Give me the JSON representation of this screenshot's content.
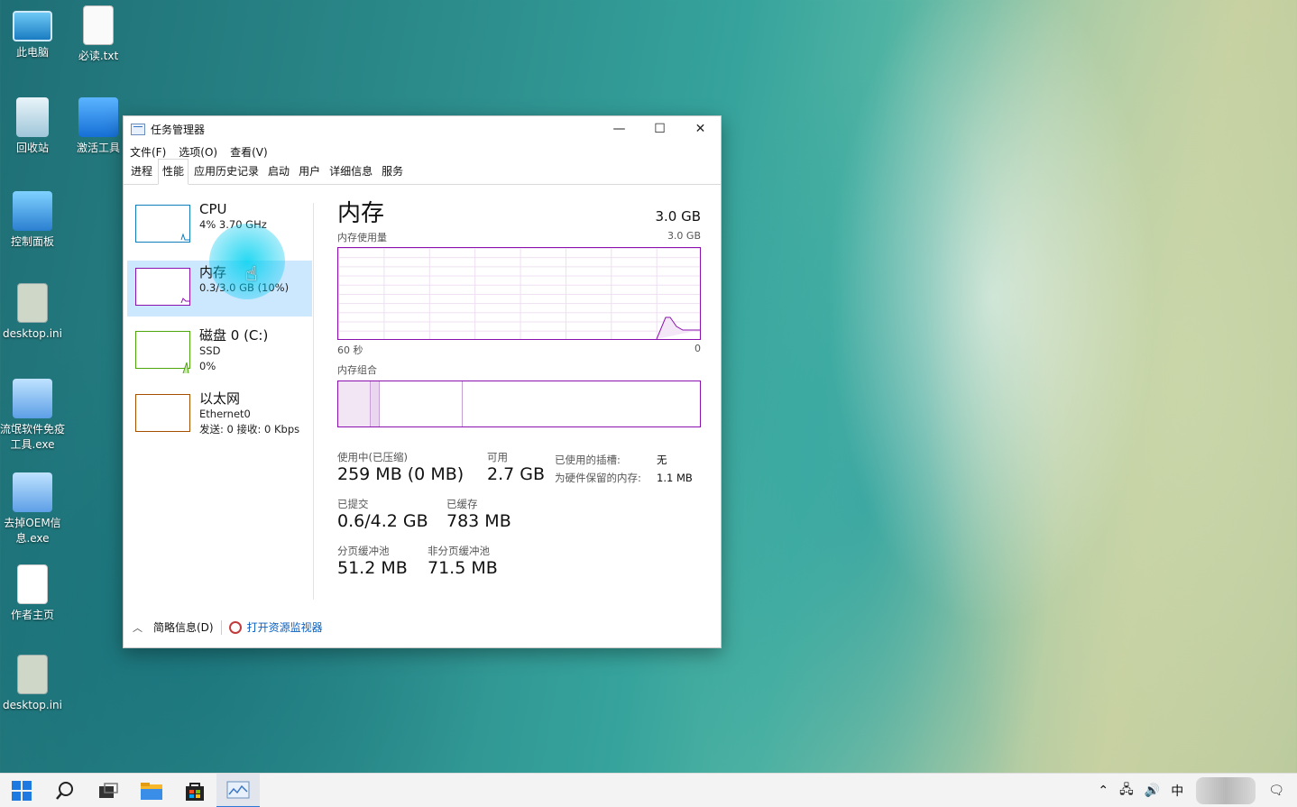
{
  "desktop": {
    "icons": [
      "此电脑",
      "必读.txt",
      "回收站",
      "激活工具",
      "控制面板",
      "desktop.ini",
      "流氓软件免疫工具.exe",
      "去掉OEM信息.exe",
      "作者主页",
      "desktop.ini"
    ]
  },
  "window": {
    "title": "任务管理器",
    "controls": {
      "minimize": "—",
      "maximize": "☐",
      "close": "✕"
    },
    "menu": [
      "文件(F)",
      "选项(O)",
      "查看(V)"
    ],
    "tabs": [
      "进程",
      "性能",
      "应用历史记录",
      "启动",
      "用户",
      "详细信息",
      "服务"
    ],
    "active_tab": "性能"
  },
  "resources": [
    {
      "name": "CPU",
      "sub1": "4% 3.70 GHz",
      "sub2": "",
      "color": "#117dbb"
    },
    {
      "name": "内存",
      "sub1": "0.3/3.0 GB (10%)",
      "sub2": "",
      "color": "#8b12ae",
      "selected": true
    },
    {
      "name": "磁盘 0 (C:)",
      "sub1": "SSD",
      "sub2": "0%",
      "color": "#4da60c"
    },
    {
      "name": "以太网",
      "sub1": "Ethernet0",
      "sub2": "发送: 0 接收: 0 Kbps",
      "color": "#a74f01"
    }
  ],
  "memory": {
    "title": "内存",
    "total": "3.0 GB",
    "usage_label": "内存使用量",
    "usage_max": "3.0 GB",
    "axis_left": "60 秒",
    "axis_right": "0",
    "composition_label": "内存组合",
    "stats": {
      "in_use_label": "使用中(已压缩)",
      "in_use_value": "259 MB (0 MB)",
      "available_label": "可用",
      "available_value": "2.7 GB",
      "slots_label": "已使用的插槽:",
      "slots_value": "无",
      "reserved_label": "为硬件保留的内存:",
      "reserved_value": "1.1 MB",
      "committed_label": "已提交",
      "committed_value": "0.6/4.2 GB",
      "cached_label": "已缓存",
      "cached_value": "783 MB",
      "paged_label": "分页缓冲池",
      "paged_value": "51.2 MB",
      "nonpaged_label": "非分页缓冲池",
      "nonpaged_value": "71.5 MB"
    }
  },
  "footer": {
    "summary": "简略信息(D)",
    "resource_monitor": "打开资源监视器"
  },
  "taskbar": {
    "ime": "中"
  }
}
